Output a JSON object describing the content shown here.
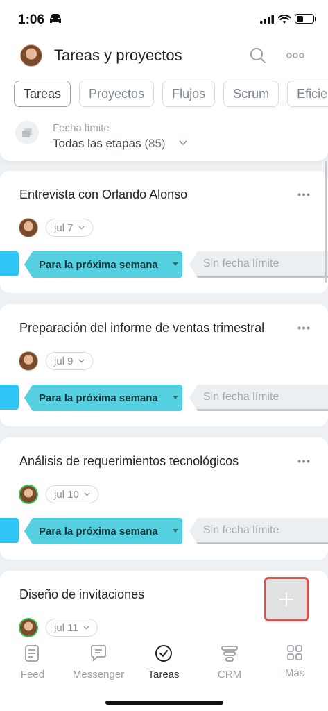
{
  "status_bar": {
    "time": "1:06"
  },
  "header": {
    "title": "Tareas y proyectos",
    "tabs": [
      {
        "label": "Tareas",
        "active": true
      },
      {
        "label": "Proyectos",
        "active": false
      },
      {
        "label": "Flujos",
        "active": false
      },
      {
        "label": "Scrum",
        "active": false
      },
      {
        "label": "Eficie",
        "active": false
      }
    ],
    "filter": {
      "label": "Fecha límite",
      "value": "Todas las etapas",
      "count": "(85)"
    }
  },
  "tasks": [
    {
      "title": "Entrevista con Orlando Alonso",
      "date": "jul 7",
      "stage_active": "Para la próxima semana",
      "stage_next": "Sin fecha límite"
    },
    {
      "title": "Preparación del informe de ventas trimestral",
      "date": "jul 9",
      "stage_active": "Para la próxima semana",
      "stage_next": "Sin fecha límite"
    },
    {
      "title": "Análisis de requerimientos tecnológicos",
      "date": "jul 10",
      "stage_active": "Para la próxima semana",
      "stage_next": "Sin fecha límite"
    },
    {
      "title": "Diseño de invitaciones",
      "date": "jul 11"
    }
  ],
  "bottom_nav": [
    {
      "label": "Feed",
      "icon": "feed-icon"
    },
    {
      "label": "Messenger",
      "icon": "messenger-icon"
    },
    {
      "label": "Tareas",
      "icon": "tasks-check-icon",
      "active": true
    },
    {
      "label": "CRM",
      "icon": "crm-icon"
    },
    {
      "label": "Más",
      "icon": "grid-icon"
    }
  ],
  "colors": {
    "accent_stage": "#55d0e0",
    "stage_block": "#2fc6f6",
    "fab_highlight": "#d9534f"
  }
}
